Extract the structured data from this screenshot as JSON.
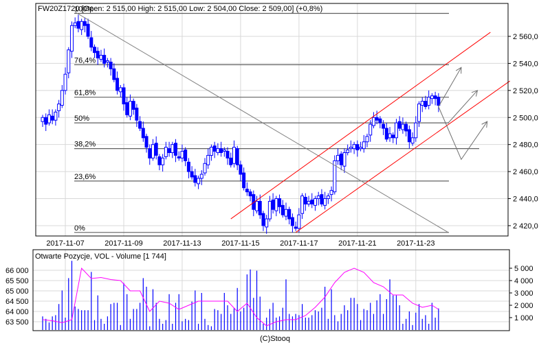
{
  "chart_data": [
    {
      "type": "candlestick",
      "title": "FW20Z1720 [Open: 2 515,00  High: 2 515,00  Low: 2 504,00  Close: 2 509,00] (+0,8%)",
      "ylim": [
        2412,
        2582
      ],
      "y_ticks": [
        2420,
        2440,
        2460,
        2480,
        2500,
        2520,
        2540,
        2560
      ],
      "y_tick_labels": [
        "2 420,0",
        "2 440,0",
        "2 460,0",
        "2 480,0",
        "2 500,0",
        "2 520,0",
        "2 540,0",
        "2 560,0"
      ],
      "x_tick_labels": [
        {
          "label": "2017-11-07",
          "candle": 7
        },
        {
          "label": "2017-11-09",
          "candle": 25
        },
        {
          "label": "2017-11-13",
          "candle": 43
        },
        {
          "label": "2017-11-15",
          "candle": 61
        },
        {
          "label": "2017-11-17",
          "candle": 79
        },
        {
          "label": "2017-11-21",
          "candle": 97
        },
        {
          "label": "2017-11-23",
          "candle": 115
        }
      ],
      "closes": [
        2500,
        2495,
        2502,
        2498,
        2504,
        2510,
        2520,
        2532,
        2550,
        2568,
        2570,
        2566,
        2571,
        2568,
        2560,
        2552,
        2548,
        2544,
        2546,
        2540,
        2542,
        2536,
        2528,
        2520,
        2522,
        2510,
        2502,
        2512,
        2506,
        2498,
        2492,
        2485,
        2478,
        2470,
        2480,
        2472,
        2465,
        2470,
        2478,
        2474,
        2480,
        2472,
        2470,
        2475,
        2468,
        2460,
        2456,
        2452,
        2455,
        2458,
        2466,
        2472,
        2478,
        2475,
        2477,
        2474,
        2476,
        2470,
        2465,
        2478,
        2465,
        2458,
        2448,
        2445,
        2442,
        2432,
        2438,
        2428,
        2420,
        2425,
        2438,
        2432,
        2440,
        2434,
        2428,
        2432,
        2425,
        2420,
        2418,
        2428,
        2442,
        2436,
        2438,
        2436,
        2440,
        2442,
        2436,
        2440,
        2442,
        2446,
        2468,
        2472,
        2465,
        2474,
        2476,
        2478,
        2480,
        2476,
        2478,
        2482,
        2486,
        2495,
        2500,
        2498,
        2496,
        2492,
        2484,
        2488,
        2485,
        2496,
        2492,
        2495,
        2490,
        2482,
        2485,
        2496,
        2510,
        2512,
        2508,
        2515,
        2516,
        2514,
        2509
      ],
      "last": {
        "open": 2515,
        "high": 2515,
        "low": 2504,
        "close": 2509,
        "change": "+0,8%"
      },
      "fibonacci": {
        "low": 2415,
        "high": 2577,
        "levels": [
          {
            "label": "0%",
            "value": 2415
          },
          {
            "label": "23,6%",
            "value": 2453
          },
          {
            "label": "38,2%",
            "value": 2477
          },
          {
            "label": "50%",
            "value": 2496
          },
          {
            "label": "61,8%",
            "value": 2515
          },
          {
            "label": "76,4%",
            "value": 2539
          },
          {
            "label": "100%",
            "value": 2577
          }
        ]
      },
      "trendlines": [
        {
          "name": "downtrend",
          "from": [
            10,
            2578
          ],
          "to": [
            125,
            2415
          ],
          "color": "#808080"
        },
        {
          "name": "channel-upper",
          "from": [
            58,
            2425
          ],
          "to": [
            138,
            2563
          ],
          "color": "#ff0000"
        },
        {
          "name": "channel-lower",
          "from": [
            78,
            2415
          ],
          "to": [
            144,
            2527
          ],
          "color": "#ff0000"
        }
      ],
      "scenario_arrows": [
        {
          "points": [
            [
              122,
              2508
            ],
            [
              129,
              2537
            ]
          ]
        },
        {
          "points": [
            [
              125,
              2496
            ],
            [
              134,
              2520
            ]
          ]
        },
        {
          "points": [
            [
              122,
              2508
            ],
            [
              129,
              2469
            ],
            [
              137,
              2497
            ]
          ]
        }
      ]
    },
    {
      "type": "bar+line",
      "title": "Otwarte Pozycje, VOL - Volume [1 744]",
      "volume_ylim": [
        0,
        6000
      ],
      "volume_ticks": [
        1000,
        2000,
        3000,
        4000,
        5000
      ],
      "volume_tick_labels": [
        "1 000",
        "2 000",
        "3 000",
        "4 000",
        "5 000"
      ],
      "oi_ylim": [
        63050,
        66950
      ],
      "oi_ticks": [
        63500,
        64000,
        64500,
        65000,
        65500,
        66000
      ],
      "oi_tick_labels": [
        "63 500",
        "64 000",
        "64 500",
        "65 000",
        "65 500",
        "66 000"
      ],
      "volume": [
        1100,
        900,
        600,
        1100,
        1200,
        2100,
        3200,
        1000,
        4200,
        5600,
        1900,
        1700,
        1600,
        1600,
        1600,
        4700,
        800,
        2800,
        900,
        500,
        1100,
        2100,
        2200,
        2200,
        400,
        3800,
        2900,
        900,
        1700,
        1700,
        2200,
        4200,
        3500,
        300,
        3300,
        2200,
        900,
        500,
        800,
        2900,
        500,
        2200,
        2900,
        700,
        900,
        800,
        2300,
        3200,
        500,
        3000,
        900,
        400,
        300,
        1700,
        1600,
        1300,
        3000,
        2000,
        1300,
        1800,
        3400,
        1500,
        1800,
        4500,
        4900,
        2600,
        4800,
        2700,
        500,
        1000,
        1700,
        2200,
        1000,
        1100,
        1800,
        4100,
        1300,
        1100,
        1300,
        1200,
        2100,
        1000,
        1000,
        1200,
        1600,
        1500,
        1800,
        3500,
        900,
        3300,
        1200,
        700,
        1300,
        2000,
        1600,
        2600,
        2600,
        2100,
        800,
        1700,
        1600,
        2200,
        1300,
        2400,
        2900,
        1300,
        2500,
        4100,
        2800,
        2800,
        2000,
        500,
        900,
        1500,
        400,
        1400,
        2100,
        900,
        1200,
        500,
        2200,
        1000,
        1744
      ],
      "open_interest_step": 3,
      "open_interest": [
        63600,
        63550,
        63450,
        63600,
        66100,
        65600,
        65650,
        65550,
        65500,
        65000,
        65000,
        64000,
        64500,
        64400,
        64100,
        64300,
        64500,
        64500,
        64500,
        64500,
        64000,
        64400,
        63700,
        63300,
        63500,
        63600,
        63600,
        63800,
        64200,
        64700,
        65400,
        65900,
        66100,
        65900,
        65400,
        65200,
        64800,
        64800,
        64400,
        64200,
        64300,
        64100
      ],
      "colors": {
        "volume": "#0000ff",
        "open_interest": "#ff00ff"
      }
    }
  ],
  "footer": {
    "copyright": "(C)Stooq"
  },
  "colors": {
    "candle": "#0000ff",
    "fib": "#606060",
    "grid": "#d8d8d8",
    "channel": "#ff0000",
    "trend": "#808080"
  }
}
